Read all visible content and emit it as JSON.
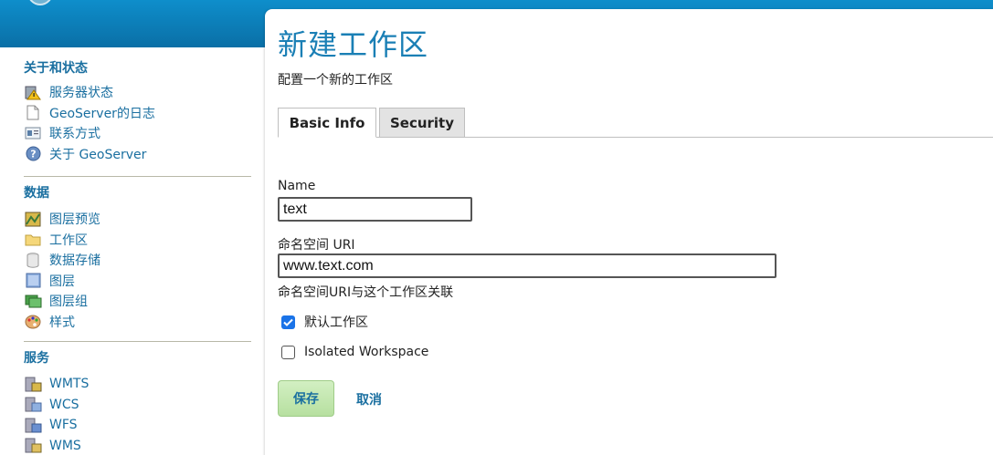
{
  "sidebar": {
    "sections": [
      {
        "title": "关于和状态",
        "items": [
          {
            "label": "服务器状态",
            "icon": "server-status-icon"
          },
          {
            "label": "GeoServer的日志",
            "icon": "log-icon"
          },
          {
            "label": "联系方式",
            "icon": "contact-icon"
          },
          {
            "label": "关于 GeoServer",
            "icon": "about-icon"
          }
        ]
      },
      {
        "title": "数据",
        "items": [
          {
            "label": "图层预览",
            "icon": "layer-preview-icon"
          },
          {
            "label": "工作区",
            "icon": "workspace-folder-icon"
          },
          {
            "label": "数据存储",
            "icon": "datastore-icon"
          },
          {
            "label": "图层",
            "icon": "layer-icon"
          },
          {
            "label": "图层组",
            "icon": "layer-group-icon"
          },
          {
            "label": "样式",
            "icon": "style-palette-icon"
          }
        ]
      },
      {
        "title": "服务",
        "items": [
          {
            "label": "WMTS",
            "icon": "wmts-icon"
          },
          {
            "label": "WCS",
            "icon": "wcs-icon"
          },
          {
            "label": "WFS",
            "icon": "wfs-icon"
          },
          {
            "label": "WMS",
            "icon": "wms-icon"
          }
        ]
      }
    ]
  },
  "main": {
    "title": "新建工作区",
    "description": "配置一个新的工作区",
    "tabs": [
      {
        "label": "Basic Info",
        "active": true
      },
      {
        "label": "Security",
        "active": false
      }
    ],
    "form": {
      "name_label": "Name",
      "name_value": "text",
      "uri_label": "命名空间 URI",
      "uri_value": "www.text.com",
      "uri_help": "命名空间URI与这个工作区关联",
      "default_label": "默认工作区",
      "default_checked": true,
      "isolated_label": "Isolated Workspace",
      "isolated_checked": false
    },
    "save_label": "保存",
    "cancel_label": "取消"
  },
  "colors": {
    "header": "#0a7dbb",
    "link": "#1a6fa0",
    "title": "#1a7fb5",
    "save_button": "#c4e8b0"
  }
}
